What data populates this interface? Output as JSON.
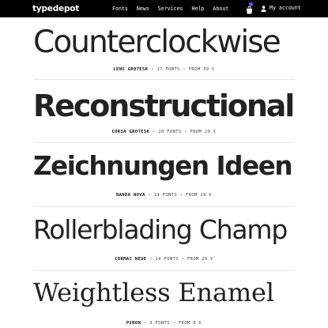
{
  "header": {
    "logo": "typedepot",
    "nav": [
      "Fonts",
      "News",
      "Services",
      "Help",
      "About"
    ],
    "account_label": "My account",
    "cart_icon": "bag-icon",
    "account_icon": "user-icon",
    "cart_badge_color": "#6f4cff"
  },
  "specimens": [
    {
      "sample": "Counterclockwise",
      "family": "LENS GROTESK",
      "fonts": "17 FONTS",
      "price": "FROM 39 €"
    },
    {
      "sample": "Reconstructional",
      "family": "CORSA GROTESK",
      "fonts": "20 FONTS",
      "price": "FROM 29 €"
    },
    {
      "sample": "Zeichnungen Ideen",
      "family": "BANDA NOVA",
      "fonts": "14 FONTS",
      "price": "FROM 29 €"
    },
    {
      "sample": "Rollerblading Champ",
      "family": "CORMAC NEUE",
      "fonts": "14 FONTS",
      "price": "FROM 29 €"
    },
    {
      "sample": "Weightless Enamel",
      "family": "PIRON",
      "fonts": "3 FONTS",
      "price": "FROM 0 €"
    }
  ]
}
